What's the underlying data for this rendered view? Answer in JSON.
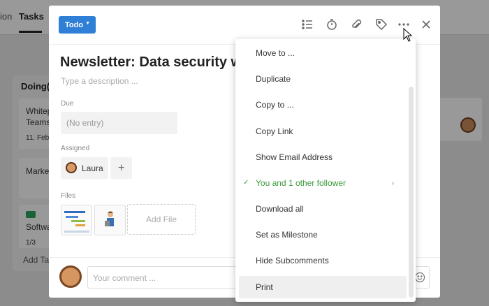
{
  "background": {
    "nav_partial": "ion",
    "nav_tasks": "Tasks",
    "column_title": "Doing(1",
    "card1_line1": "Whitep",
    "card1_line2": "Teams",
    "card1_date": "11. Feb",
    "card2": "Marke",
    "card3": "Softwa",
    "card3_sub": "1/3",
    "add_task": "Add Ta"
  },
  "header": {
    "status": "Todo",
    "icons": [
      "checklist-icon",
      "stopwatch-icon",
      "paperclip-icon",
      "tag-icon",
      "more-icon",
      "close-icon"
    ]
  },
  "task": {
    "title": "Newsletter: Data security w",
    "description_placeholder": "Type a description ...",
    "due_label": "Due",
    "due_value": "(No entry)",
    "assigned_label": "Assigned",
    "assignee": "Laura",
    "add_assignee": "+",
    "files_label": "Files",
    "add_file": "Add File"
  },
  "footer": {
    "comment_placeholder": "Your comment ..."
  },
  "menu": {
    "items": [
      {
        "label": "Move to ..."
      },
      {
        "label": "Duplicate"
      },
      {
        "label": "Copy to ..."
      },
      {
        "label": "Copy Link"
      },
      {
        "label": "Show Email Address"
      },
      {
        "label": "You and 1 other follower",
        "checked": true
      },
      {
        "label": "Download all"
      },
      {
        "label": "Set as Milestone"
      },
      {
        "label": "Hide Subcomments"
      },
      {
        "label": "Print",
        "hover": true
      }
    ]
  },
  "colors": {
    "accent": "#2f7fd6",
    "follower_green": "#3a9a3a"
  }
}
